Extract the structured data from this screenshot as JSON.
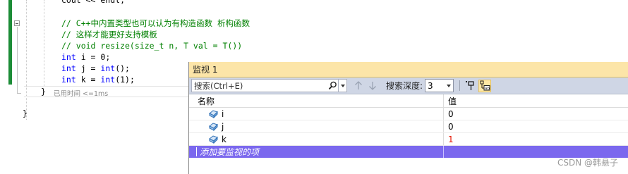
{
  "editor": {
    "lines": {
      "cout": "cout << endl;",
      "comment1": "// C++中内置类型也可以认为有构造函数 析构函数",
      "comment2": "// 这样才能更好支持模板",
      "comment3": "// void resize(size_t n, T val = T())",
      "decl_i_kw": "int",
      "decl_i_rest": " i = 0;",
      "decl_j_kw": "int",
      "decl_j_mid": " j = ",
      "decl_j_kw2": "int",
      "decl_j_end": "();",
      "decl_k_kw": "int",
      "decl_k_mid": " k = ",
      "decl_k_kw2": "int",
      "decl_k_end": "(1);",
      "close_inner": "}",
      "close_outer": "}"
    },
    "elapsed": "已用时间 <=1ms",
    "colors": {
      "comment": "#008000",
      "keyword": "#0000ff",
      "change_bar": "#1c8c37"
    }
  },
  "watch": {
    "title": "监视 1",
    "search_placeholder": "搜索(Ctrl+E)",
    "depth_label": "搜索深度:",
    "depth_value": "3",
    "columns": {
      "name": "名称",
      "value": "值"
    },
    "rows": [
      {
        "name": "i",
        "value": "0",
        "changed": false
      },
      {
        "name": "j",
        "value": "0",
        "changed": false
      },
      {
        "name": "k",
        "value": "1",
        "changed": true
      }
    ],
    "add_item": "添加要监视的项",
    "colors": {
      "title_bg": "#fce5a8",
      "toolbar_bg": "#cfd6e5",
      "add_row_bg": "#7b68ee",
      "changed_value": "#e51400"
    }
  },
  "watermark": "CSDN @韩悬子"
}
